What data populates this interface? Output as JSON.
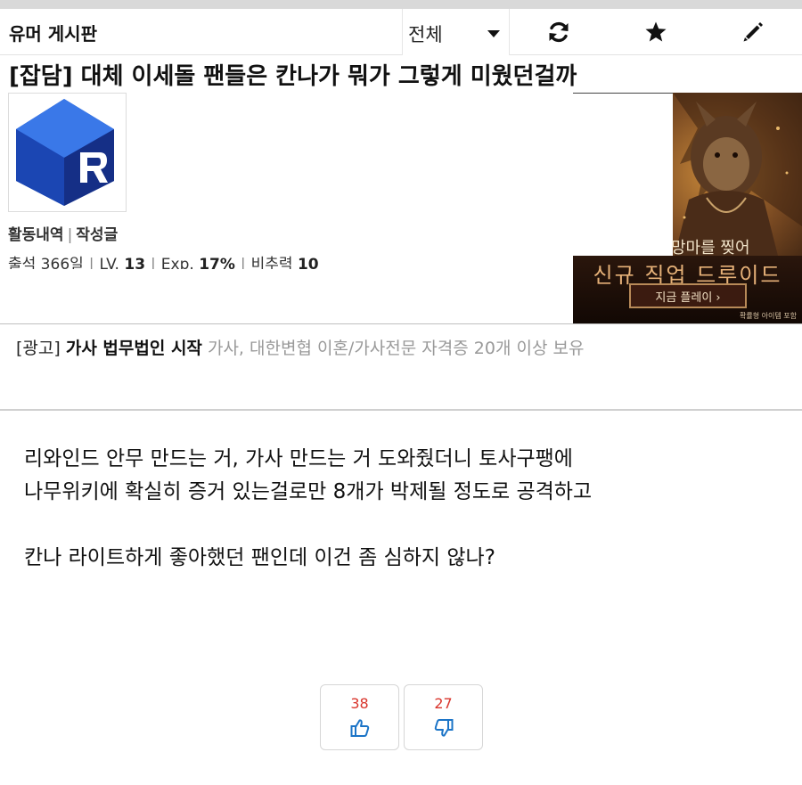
{
  "header": {
    "board_title": "유머 게시판",
    "filter": {
      "selected": "전체"
    },
    "buttons": [
      "refresh-icon",
      "star-icon",
      "pencil-icon"
    ]
  },
  "post": {
    "title": "[잡담] 대체 이세돌 팬들은 칸나가 뭐가 그렇게 미웠던걸까",
    "author": {
      "activity_label": "활동내역",
      "posts_label": "작성글",
      "attendance": "출석 366일",
      "level_label": "LV.",
      "level": "13",
      "exp_label": "Exp.",
      "exp": "17%",
      "manner_label": "비추력",
      "manner": "10"
    },
    "body": [
      "리와인드 안무 만드는 거, 가사 만드는 거 도와줬더니 토사구팽에",
      "나무위키에 확실히 증거 있는걸로만 8개가 박제될 정도로 공격하고",
      "",
      "칸나 라이트하게 좋아했던 팬인데 이건 좀 심하지 않나?"
    ],
    "votes": {
      "up": "38",
      "down": "27"
    }
  },
  "banner_ad": {
    "line1": "망마를 찢어",
    "line2": "신규 직업 드루이드",
    "button": "지금 플레이 ›",
    "note": "확률형 아이템 포함"
  },
  "text_ad": {
    "tag": "[광고]",
    "name": "가사 법무법인 시작",
    "desc": "가사, 대한변협 이혼/가사전문 자격증 20개 이상 보유"
  },
  "colors": {
    "vote_count": "#d9342b",
    "vote_icon": "#1b74c7",
    "logo_blue": "#1e5bd6"
  }
}
